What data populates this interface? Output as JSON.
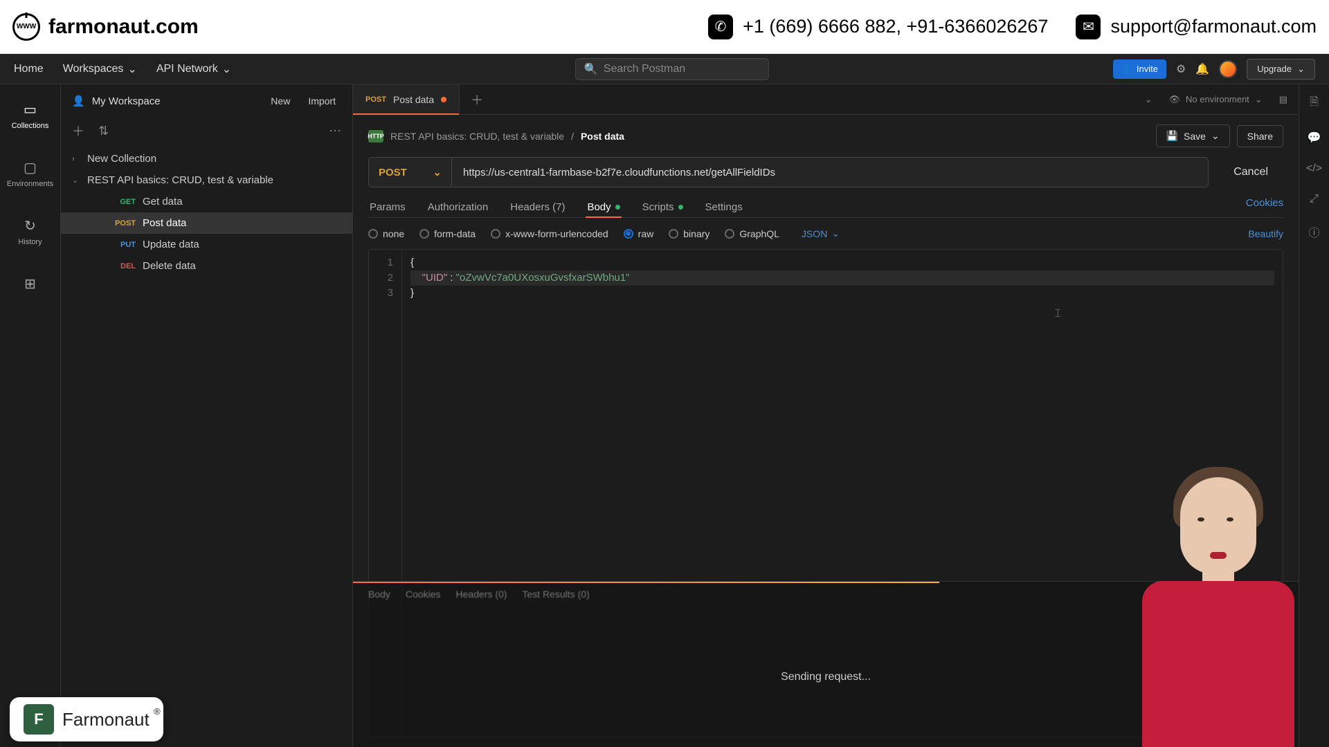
{
  "topbar": {
    "domain": "farmonaut.com",
    "phone": "+1 (669) 6666 882, +91-6366026267",
    "email": "support@farmonaut.com"
  },
  "header": {
    "home": "Home",
    "workspaces": "Workspaces",
    "api_network": "API Network",
    "search_placeholder": "Search Postman",
    "invite": "Invite",
    "upgrade": "Upgrade"
  },
  "rail": {
    "collections": "Collections",
    "environments": "Environments",
    "history": "History"
  },
  "sidebar": {
    "title": "My Workspace",
    "new_btn": "New",
    "import_btn": "Import",
    "tree": {
      "col1": "New Collection",
      "col2": "REST API basics: CRUD, test & variable",
      "items": [
        {
          "method": "GET",
          "label": "Get data"
        },
        {
          "method": "POST",
          "label": "Post data"
        },
        {
          "method": "PUT",
          "label": "Update data"
        },
        {
          "method": "DEL",
          "label": "Delete data"
        }
      ]
    }
  },
  "tabs": {
    "active_method": "POST",
    "active_label": "Post data",
    "no_env": "No environment"
  },
  "breadcrumb": {
    "icon_text": "HTTP",
    "parent": "REST API basics: CRUD, test & variable",
    "sep": "/",
    "current": "Post data",
    "save": "Save",
    "share": "Share"
  },
  "request": {
    "method": "POST",
    "url": "https://us-central1-farmbase-b2f7e.cloudfunctions.net/getAllFieldIDs",
    "cancel": "Cancel"
  },
  "req_tabs": {
    "params": "Params",
    "auth": "Authorization",
    "headers": "Headers (7)",
    "body": "Body",
    "scripts": "Scripts",
    "settings": "Settings",
    "cookies": "Cookies"
  },
  "body_opts": {
    "none": "none",
    "form": "form-data",
    "url": "x-www-form-urlencoded",
    "raw": "raw",
    "binary": "binary",
    "graphql": "GraphQL",
    "json": "JSON",
    "beautify": "Beautify"
  },
  "code": {
    "l1": "{",
    "l2_key": "\"UID\"",
    "l2_colon": " : ",
    "l2_val": "\"oZvwVc7a0UXosxuGvsfxarSWbhu1\"",
    "l3": "}",
    "g1": "1",
    "g2": "2",
    "g3": "3"
  },
  "response": {
    "body": "Body",
    "cookies": "Cookies",
    "headers": "Headers (0)",
    "test": "Test Results (0)",
    "status": "Sending request..."
  },
  "watermark": {
    "text": "Farmonaut"
  }
}
